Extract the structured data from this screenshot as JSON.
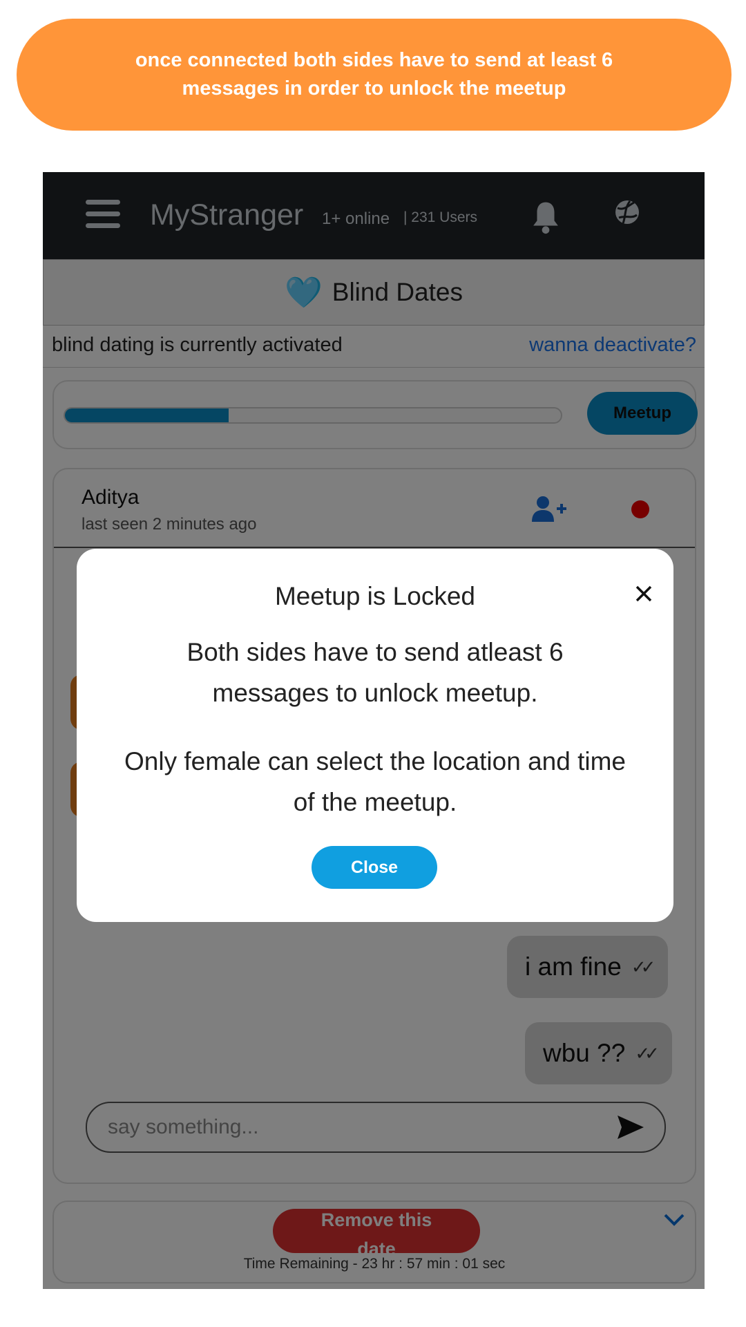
{
  "banner": {
    "text": "once connected both sides have to send at least 6 messages in order to unlock the meetup"
  },
  "header": {
    "brand": "MyStranger",
    "online": "1+ online",
    "users": "| 231 Users",
    "icons": [
      "menu-icon",
      "bell-icon",
      "globe-icon"
    ]
  },
  "blind_dates": {
    "heart": "🩵",
    "title": "Blind Dates",
    "status": "blind dating is currently activated",
    "deactivate_link": "wanna deactivate?"
  },
  "progress": {
    "fraction": 0.33,
    "meetup_label": "Meetup"
  },
  "chat": {
    "contact_name": "Aditya",
    "last_seen": "last seen 2 minutes ago",
    "messages": [
      {
        "text": "i am fine",
        "ticks": "✓✓"
      },
      {
        "text": "wbu ??",
        "ticks": "✓✓"
      }
    ],
    "input_placeholder": "say something..."
  },
  "date_actions": {
    "remove_label": "Remove this date",
    "time_remaining": "Time Remaining - 23 hr : 57 min : 01 sec"
  },
  "modal": {
    "title": "Meetup is Locked",
    "body1": "Both sides have to send atleast 6 messages to unlock meetup.",
    "body2": "Only female can select the location and time of the meetup.",
    "close_label": "Close"
  },
  "colors": {
    "banner": "#FF9539",
    "topbar": "#212529",
    "accent": "#0a8cc7",
    "danger": "#dc3030",
    "modal_button": "#109fe0"
  }
}
